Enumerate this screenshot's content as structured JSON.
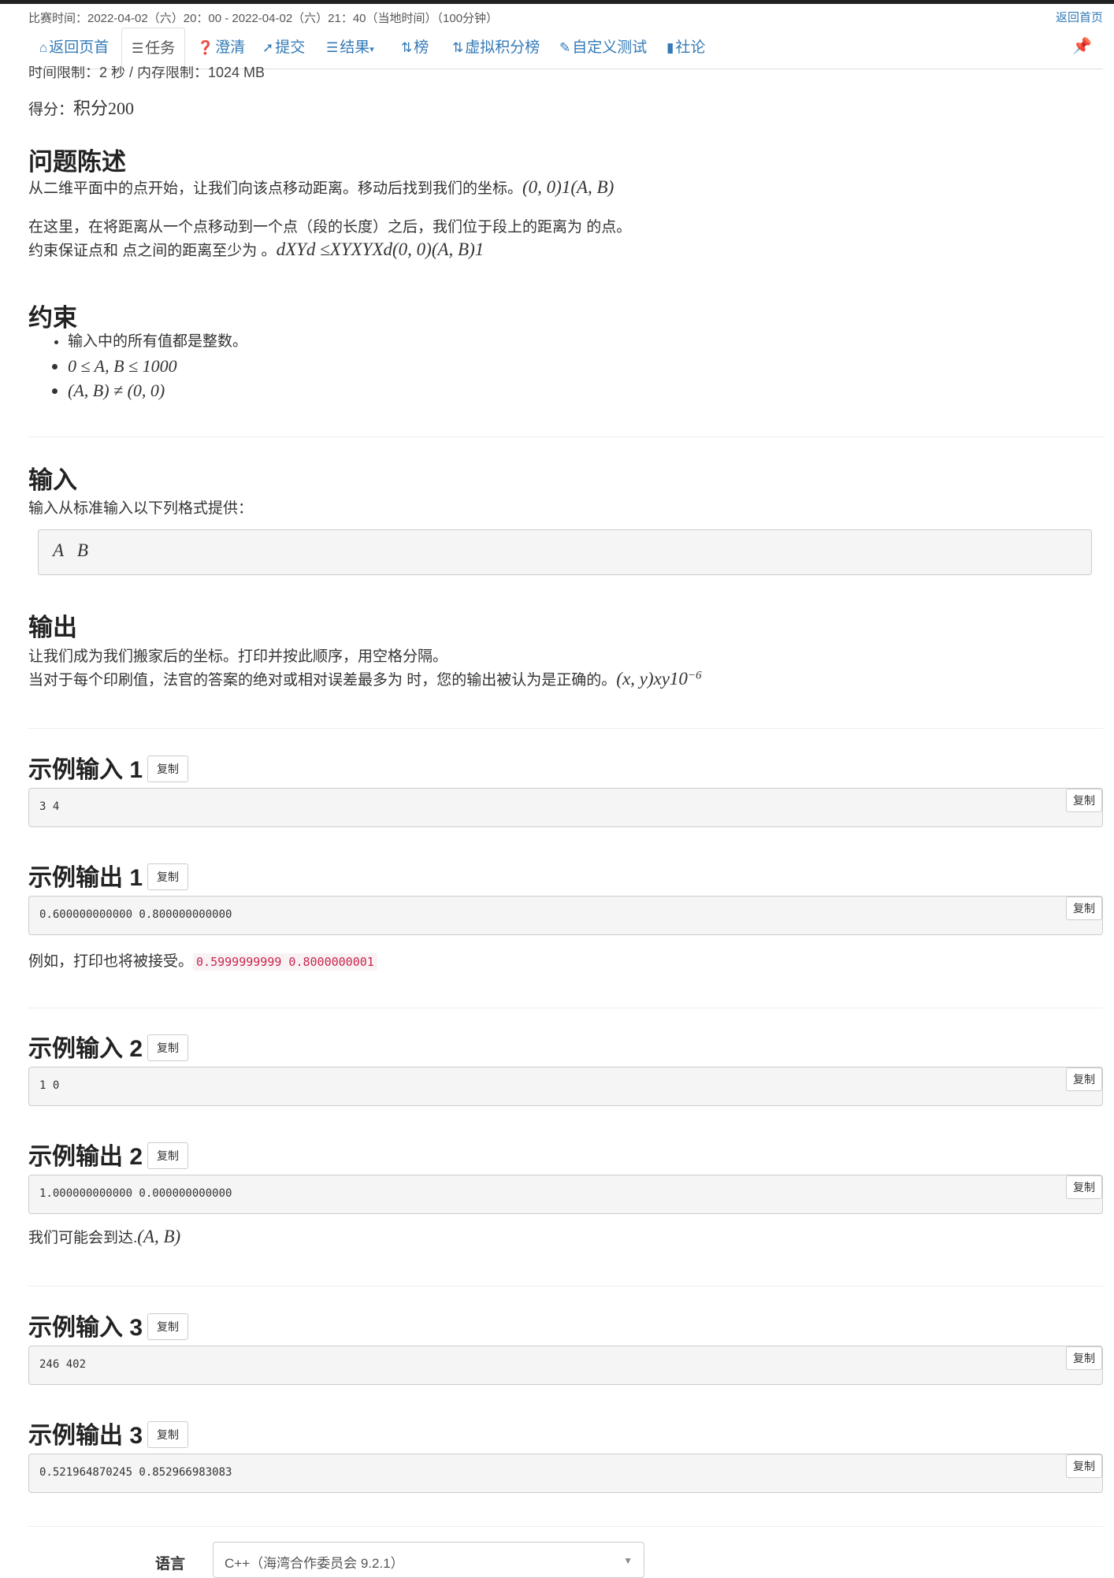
{
  "contest_time": "比赛时间：2022-04-02（六）20：00 - 2022-04-02（六）21：40（当地时间）（100分钟）",
  "home_link": "返回首页",
  "nav": {
    "back": "返回页首",
    "tasks": "任务",
    "clarify": "澄清",
    "submit": "提交",
    "results": "结果",
    "standings": "榜",
    "virtual_standings": "虚拟积分榜",
    "custom_test": "自定义测试",
    "editorial": "社论"
  },
  "limits": "时间限制：2 秒 / 内存限制：1024 MB",
  "score_label": "得分：",
  "score_value": "积分200",
  "statement": {
    "heading": "问题陈述",
    "line1_text": "从二维平面中的点开始，让我们向该点移动距离。移动后找到我们的坐标。",
    "line1_math": "(0, 0)1(A, B)",
    "line2_text": "在这里，在将距离从一个点移动到一个点（段的长度）之后，我们位于段上的距离为 的点。",
    "line3_text": "约束保证点和 点之间的距离至少为 。",
    "line3_math": "dXYd ≤XYXYXd(0, 0)(A, B)1"
  },
  "constraints": {
    "heading": "约束",
    "items": [
      "输入中的所有值都是整数。",
      "0 ≤ A, B ≤ 1000",
      "(A, B) ≠ (0, 0)"
    ]
  },
  "input": {
    "heading": "输入",
    "desc": "输入从标准输入以下列格式提供：",
    "format": "A   B"
  },
  "output": {
    "heading": "输出",
    "line1": "让我们成为我们搬家后的坐标。打印并按此顺序，用空格分隔。",
    "line2_text": "当对于每个印刷值，法官的答案的绝对或相对误差最多为 时，您的输出被认为是正确的。",
    "line2_math": "(x, y)xy10",
    "line2_exp": "−6"
  },
  "copy_label": "复制",
  "samples": [
    {
      "title": "示例输入 1",
      "value": "3 4"
    },
    {
      "title": "示例输出 1",
      "value": "0.600000000000 0.800000000000"
    },
    {
      "title": "示例输入 2",
      "value": "1 0"
    },
    {
      "title": "示例输出 2",
      "value": "1.000000000000 0.000000000000"
    },
    {
      "title": "示例输入 3",
      "value": "246 402"
    },
    {
      "title": "示例输出 3",
      "value": "0.521964870245 0.852966983083"
    }
  ],
  "note1_text": "例如，打印也将被接受。",
  "note1_code": "0.5999999999 0.8000000001",
  "note2_text": "我们可能会到达.",
  "note2_math": "(A, B)",
  "language_label": "语言",
  "language_value": "C++（海湾合作委员会 9.2.1）"
}
